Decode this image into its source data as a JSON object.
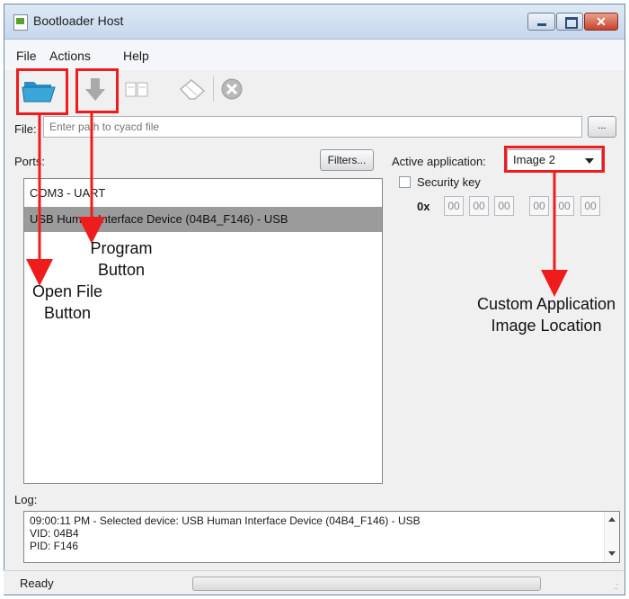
{
  "window": {
    "title": "Bootloader Host"
  },
  "menu": {
    "file": "File",
    "actions": "Actions",
    "help": "Help"
  },
  "toolbar": {
    "open_icon": "folder-open-icon",
    "program_icon": "download-arrow-icon",
    "verify_icon": "document-compare-icon",
    "erase_icon": "eraser-icon",
    "abort_icon": "stop-icon"
  },
  "file": {
    "label": "File:",
    "placeholder": "Enter path to cyacd file",
    "browse_label": "..."
  },
  "ports": {
    "label": "Ports:",
    "filters_label": "Filters...",
    "items": [
      "COM3 - UART",
      "USB Human Interface Device (04B4_F146) - USB"
    ],
    "selected_index": 1
  },
  "active_app": {
    "label": "Active application:",
    "value": "Image 2"
  },
  "security": {
    "label": "Security key",
    "checked": false,
    "prefix": "0x",
    "bytes": [
      "00",
      "00",
      "00",
      "00",
      "00",
      "00"
    ]
  },
  "annotations": {
    "program": [
      "Program",
      "Button"
    ],
    "open_file": [
      "Open File",
      "Button"
    ],
    "image": [
      "Custom Application",
      "Image Location"
    ],
    "color": "#ee1c1c"
  },
  "log": {
    "label": "Log:",
    "lines": [
      "09:00:11 PM - Selected device: USB Human Interface Device (04B4_F146) - USB",
      "VID: 04B4",
      "PID: F146"
    ]
  },
  "status": {
    "text": "Ready",
    "progress": 0
  }
}
